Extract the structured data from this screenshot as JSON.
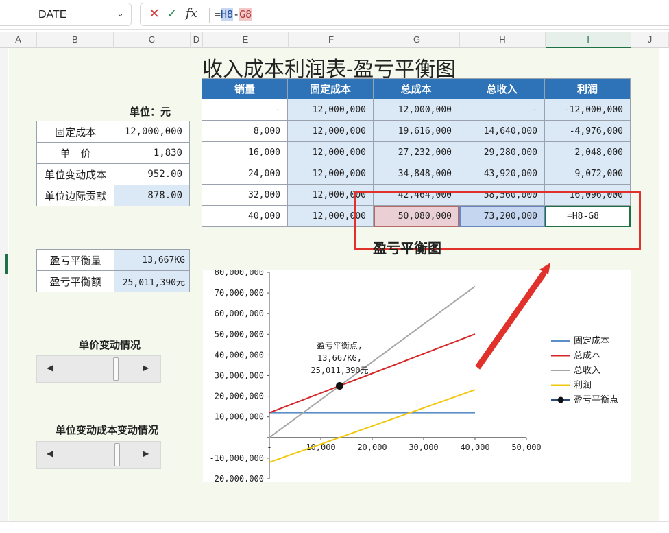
{
  "formula_bar": {
    "name_box": "DATE",
    "fx_label": "fx",
    "formula_parts": [
      "=",
      "H8",
      "-",
      "G8"
    ]
  },
  "columns": [
    "A",
    "B",
    "C",
    "D",
    "E",
    "F",
    "G",
    "H",
    "I",
    "J"
  ],
  "sheet": {
    "title": "收入成本利润表-盈亏平衡图",
    "unit_label": "单位：元",
    "params": [
      {
        "label": "固定成本",
        "value": "12,000,000"
      },
      {
        "label": "单　价",
        "value": "1,830"
      },
      {
        "label": "单位变动成本",
        "value": "952.00"
      },
      {
        "label": "单位边际贡献",
        "value": "878.00"
      }
    ],
    "breakeven": [
      {
        "label": "盈亏平衡量",
        "value": "13,667KG"
      },
      {
        "label": "盈亏平衡额",
        "value": "25,011,390元"
      }
    ],
    "table": {
      "headers": [
        "销量",
        "固定成本",
        "总成本",
        "总收入",
        "利润"
      ],
      "rows": [
        [
          "-",
          "12,000,000",
          "12,000,000",
          "-",
          "-12,000,000"
        ],
        [
          "8,000",
          "12,000,000",
          "19,616,000",
          "14,640,000",
          "-4,976,000"
        ],
        [
          "16,000",
          "12,000,000",
          "27,232,000",
          "29,280,000",
          "2,048,000"
        ],
        [
          "24,000",
          "12,000,000",
          "34,848,000",
          "43,920,000",
          "9,072,000"
        ],
        [
          "32,000",
          "12,000,000",
          "42,464,000",
          "58,560,000",
          "16,096,000"
        ],
        [
          "40,000",
          "12,000,000",
          "50,080,000",
          "73,200,000",
          "=H8-G8"
        ]
      ]
    },
    "controls": {
      "price_title": "单价变动情况",
      "price_position": 0.68,
      "varcost_title": "单位变动成本变动情况",
      "varcost_position": 0.7
    }
  },
  "chart_data": {
    "type": "line",
    "title": "盈亏平衡图",
    "xlabel": "",
    "ylabel": "",
    "x": [
      0,
      40000
    ],
    "xlim": [
      0,
      50000
    ],
    "ylim": [
      -20000000,
      80000000
    ],
    "x_ticks": [
      "-",
      "10,000",
      "20,000",
      "30,000",
      "40,000",
      "50,000"
    ],
    "y_ticks": [
      "-20,000,000",
      "-10,000,000",
      "-",
      "10,000,000",
      "20,000,000",
      "30,000,000",
      "40,000,000",
      "50,000,000",
      "60,000,000",
      "70,000,000",
      "80,000,000"
    ],
    "series": [
      {
        "name": "固定成本",
        "color": "#5b8fc7",
        "values": [
          12000000,
          12000000
        ]
      },
      {
        "name": "总成本",
        "color": "#d62728",
        "values": [
          12000000,
          50080000
        ]
      },
      {
        "name": "总收入",
        "color": "#a6a6a6",
        "values": [
          0,
          73200000
        ]
      },
      {
        "name": "利润",
        "color": "#f2c80f",
        "values": [
          -12000000,
          23120000
        ]
      }
    ],
    "point": {
      "name": "盈亏平衡点",
      "x": 13667,
      "y": 25011390
    },
    "annotation": [
      "盈亏平衡点,",
      "13,667KG,",
      "25,011,390元"
    ],
    "legend_position": "right"
  }
}
